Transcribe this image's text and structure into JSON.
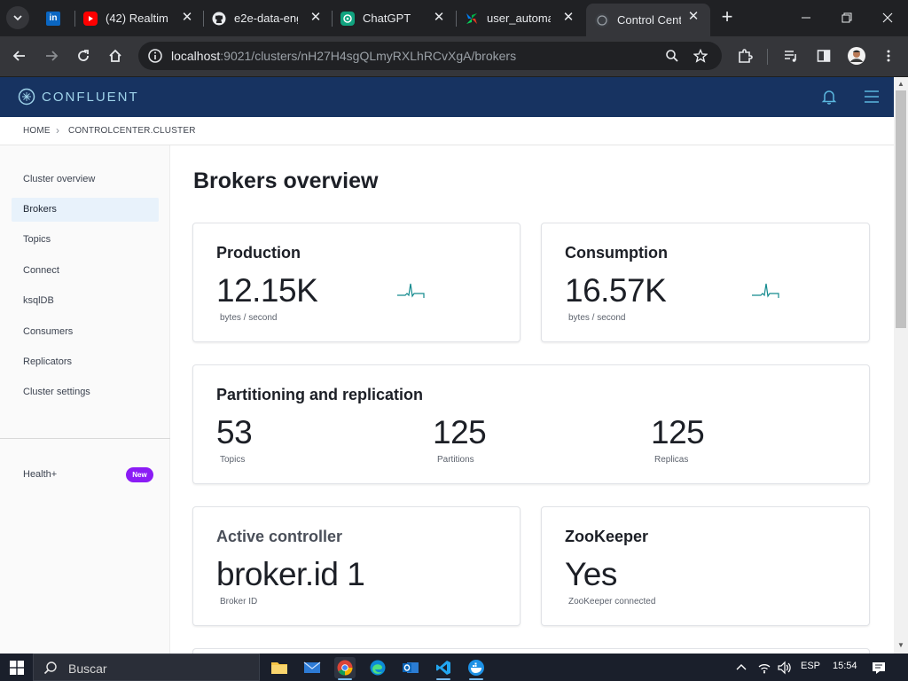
{
  "browser": {
    "tabs": [
      {
        "title": "",
        "favicon": "linkedin-icon"
      },
      {
        "title": "(42) Realtime",
        "favicon": "youtube-icon"
      },
      {
        "title": "e2e-data-eng",
        "favicon": "github-icon"
      },
      {
        "title": "ChatGPT",
        "favicon": "chatgpt-icon"
      },
      {
        "title": "user_automat",
        "favicon": "airflow-icon"
      },
      {
        "title": "Control Cente",
        "favicon": "confluent-icon",
        "active": true
      }
    ],
    "address": {
      "host": "localhost",
      "rest": ":9021/clusters/nH27H4sgQLmyRXLhRCvXgA/brokers"
    }
  },
  "app": {
    "brand": "CONFLUENT",
    "colors": {
      "header": "#173361",
      "accent": "#1f9ac7",
      "new_badge": "#8b1cf5"
    }
  },
  "breadcrumb": {
    "items": [
      "HOME",
      "CONTROLCENTER.CLUSTER"
    ]
  },
  "sidebar": {
    "items": [
      {
        "label": "Cluster overview"
      },
      {
        "label": "Brokers",
        "active": true
      },
      {
        "label": "Topics"
      },
      {
        "label": "Connect"
      },
      {
        "label": "ksqlDB"
      },
      {
        "label": "Consumers"
      },
      {
        "label": "Replicators"
      },
      {
        "label": "Cluster settings"
      }
    ],
    "health": {
      "label": "Health+",
      "badge": "New"
    }
  },
  "main": {
    "title": "Brokers overview",
    "production": {
      "title": "Production",
      "value": "12.15K",
      "unit": "bytes / second"
    },
    "consumption": {
      "title": "Consumption",
      "value": "16.57K",
      "unit": "bytes / second"
    },
    "partitioning": {
      "title": "Partitioning and replication",
      "stats": [
        {
          "value": "53",
          "label": "Topics"
        },
        {
          "value": "125",
          "label": "Partitions"
        },
        {
          "value": "125",
          "label": "Replicas"
        }
      ]
    },
    "controller": {
      "title": "Active controller",
      "value": "broker.id 1",
      "label": "Broker ID"
    },
    "zookeeper": {
      "title": "ZooKeeper",
      "value": "Yes",
      "label": "ZooKeeper connected"
    }
  },
  "taskbar": {
    "search_placeholder": "Buscar",
    "language": "ESP",
    "time": "15:54"
  }
}
